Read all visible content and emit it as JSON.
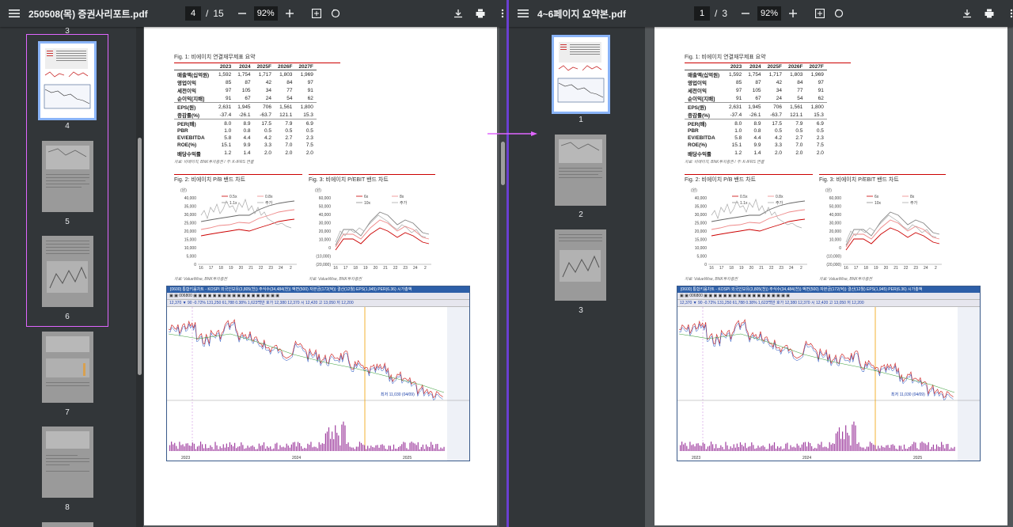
{
  "colors": {
    "toolbar": "#323639",
    "background": "#525659",
    "accent_selected": "#8ab4f8",
    "drag_highlight": "#e066ff"
  },
  "left": {
    "title": "250508(목) 증권사리포트.pdf",
    "page_current": "4",
    "page_sep": "/",
    "page_total": "15",
    "zoom": "92%",
    "thumb_top_label": "3",
    "thumbs": [
      {
        "label": "4"
      },
      {
        "label": "5"
      },
      {
        "label": "6"
      },
      {
        "label": "7"
      },
      {
        "label": "8"
      }
    ]
  },
  "right": {
    "title": "4~6페이지 요약본.pdf",
    "page_current": "1",
    "page_sep": "/",
    "page_total": "3",
    "zoom": "92%",
    "thumbs": [
      {
        "label": "1"
      },
      {
        "label": "2"
      },
      {
        "label": "3"
      }
    ]
  },
  "doc": {
    "fig1_title": "Fig. 1: 비에이치 연결재무제표 요약",
    "table_headers": [
      "",
      "2023",
      "2024",
      "2025F",
      "2026F",
      "2027F"
    ],
    "table_rows": [
      [
        "매출액(십억원)",
        "1,592",
        "1,754",
        "1,717",
        "1,803",
        "1,969"
      ],
      [
        "영업이익",
        "85",
        "87",
        "42",
        "84",
        "97"
      ],
      [
        "세전이익",
        "97",
        "105",
        "34",
        "77",
        "91"
      ],
      [
        "순이익[지배]",
        "91",
        "67",
        "24",
        "54",
        "62"
      ],
      [
        "EPS(원)",
        "2,631",
        "1,945",
        "706",
        "1,561",
        "1,800"
      ],
      [
        "증감률(%)",
        "-37.4",
        "-26.1",
        "-63.7",
        "121.1",
        "15.3"
      ],
      [
        "PER(배)",
        "8.0",
        "8.9",
        "17.5",
        "7.9",
        "6.9"
      ],
      [
        "PBR",
        "1.0",
        "0.8",
        "0.5",
        "0.5",
        "0.5"
      ],
      [
        "EV/EBITDA",
        "5.8",
        "4.4",
        "4.2",
        "2.7",
        "2.3"
      ],
      [
        "ROE(%)",
        "15.1",
        "9.9",
        "3.3",
        "7.0",
        "7.5"
      ],
      [
        "배당수익률",
        "1.2",
        "1.4",
        "2.0",
        "2.0",
        "2.0"
      ]
    ],
    "fig1_source": "자료: 비에이치, BNK투자증권 / 주: K-IFRS 연결",
    "fig2_title": "Fig. 2: 비에이치 P/B 밴드 차트",
    "fig3_title": "Fig. 3: 비에이치 P/EBIT 밴드 차트",
    "fig2_unit": "(원)",
    "fig3_unit": "(원)",
    "fig2_legend": [
      "0.5x",
      "0.8x",
      "1.1x",
      "주가"
    ],
    "fig3_legend": [
      "6x",
      "8x",
      "10x",
      "주가"
    ],
    "fig2_yticks": [
      "40,000",
      "35,000",
      "30,000",
      "25,000",
      "20,000",
      "15,000",
      "10,000",
      "5,000",
      "0"
    ],
    "fig3_yticks": [
      "60,000",
      "50,000",
      "40,000",
      "30,000",
      "20,000",
      "10,000",
      "0",
      "(10,000)",
      "(20,000)"
    ],
    "xticks": [
      "16",
      "17",
      "18",
      "19",
      "20",
      "21",
      "22",
      "23",
      "24",
      "2"
    ],
    "chart_source": "자료: ValueWise, BNK투자증권",
    "stock_title": "[0600] 통합키움차트 - KOSPI 외국인보유(3,805(천)) 주식수(34,484(천)) 액면(500) 자본금(172(억)) 결산(12월) EPS(1,945) PER(6.36) 시가총액",
    "stock_bar": "12,370 ▼ 90 -0.72% 131,250 61,788 0.38% 1,623백만 호가 12,380 12,370 시 12,420 고 13,050 저 12,200",
    "stock_low": "최저 11,030 (04/09)",
    "stock_years": [
      "2023",
      "2024",
      "2025"
    ]
  }
}
